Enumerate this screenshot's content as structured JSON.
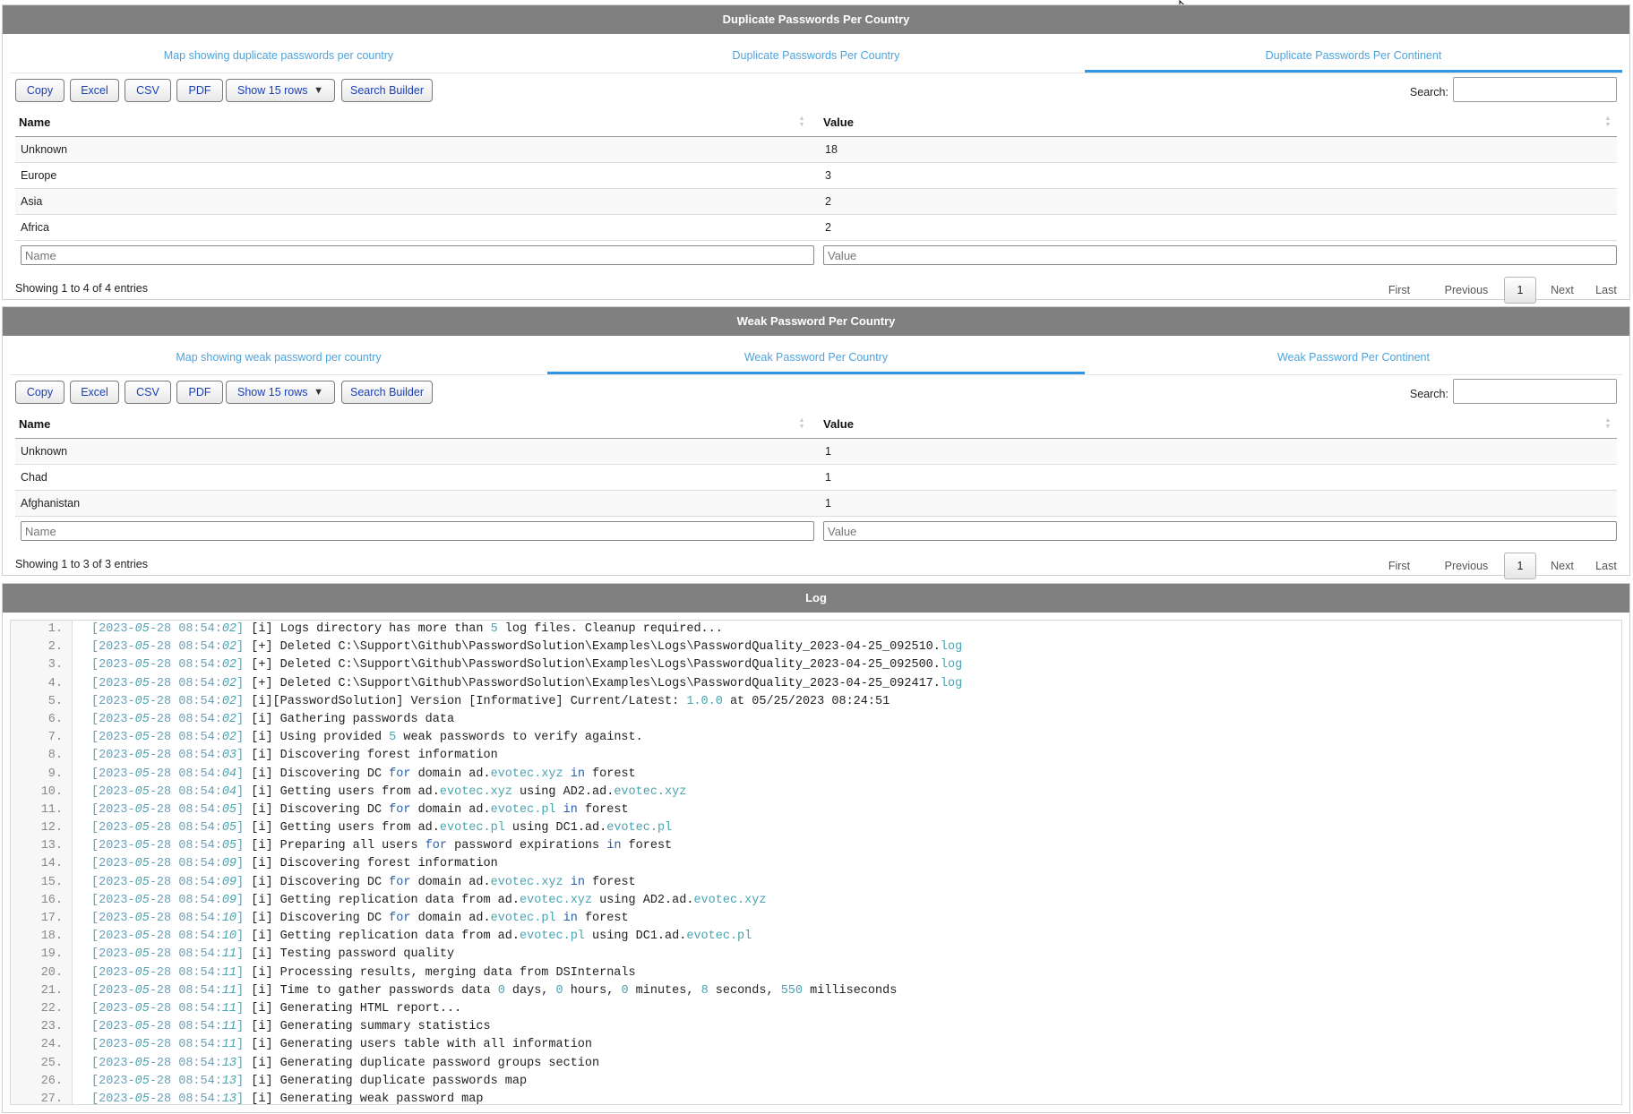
{
  "panel1": {
    "header": "Duplicate Passwords Per Country",
    "tabs": [
      "Map showing duplicate passwords per country",
      "Duplicate Passwords Per Country",
      "Duplicate Passwords Per Continent"
    ],
    "active_tab": 2,
    "buttons": {
      "copy": "Copy",
      "excel": "Excel",
      "csv": "CSV",
      "pdf": "PDF",
      "show_rows": "Show 15 rows",
      "search_builder": "Search Builder"
    },
    "search_label": "Search:",
    "columns": [
      "Name",
      "Value"
    ],
    "rows": [
      [
        "Unknown",
        "18"
      ],
      [
        "Europe",
        "3"
      ],
      [
        "Asia",
        "2"
      ],
      [
        "Africa",
        "2"
      ]
    ],
    "filter_placeholders": [
      "Name",
      "Value"
    ],
    "info": "Showing 1 to 4 of 4 entries",
    "pager": [
      "First",
      "Previous",
      "1",
      "Next",
      "Last"
    ]
  },
  "panel2": {
    "header": "Weak Password Per Country",
    "tabs": [
      "Map showing weak password per country",
      "Weak Password Per Country",
      "Weak Password Per Continent"
    ],
    "active_tab": 1,
    "buttons": {
      "copy": "Copy",
      "excel": "Excel",
      "csv": "CSV",
      "pdf": "PDF",
      "show_rows": "Show 15 rows",
      "search_builder": "Search Builder"
    },
    "search_label": "Search:",
    "columns": [
      "Name",
      "Value"
    ],
    "rows": [
      [
        "Unknown",
        "1"
      ],
      [
        "Chad",
        "1"
      ],
      [
        "Afghanistan",
        "1"
      ]
    ],
    "filter_placeholders": [
      "Name",
      "Value"
    ],
    "info": "Showing 1 to 3 of 3 entries",
    "pager": [
      "First",
      "Previous",
      "1",
      "Next",
      "Last"
    ]
  },
  "log": {
    "header": "Log",
    "lines": [
      {
        "n": "1.",
        "ts": "[2023-05-28 08:54:02]",
        "text": " [i] Logs directory has more than 5 log files. Cleanup required..."
      },
      {
        "n": "2.",
        "ts": "[2023-05-28 08:54:02]",
        "text": " [+] Deleted C:\\Support\\Github\\PasswordSolution\\Examples\\Logs\\PasswordQuality_2023-04-25_092510.log"
      },
      {
        "n": "3.",
        "ts": "[2023-05-28 08:54:02]",
        "text": " [+] Deleted C:\\Support\\Github\\PasswordSolution\\Examples\\Logs\\PasswordQuality_2023-04-25_092500.log"
      },
      {
        "n": "4.",
        "ts": "[2023-05-28 08:54:02]",
        "text": " [+] Deleted C:\\Support\\Github\\PasswordSolution\\Examples\\Logs\\PasswordQuality_2023-04-25_092417.log"
      },
      {
        "n": "5.",
        "ts": "[2023-05-28 08:54:02]",
        "text": " [i][PasswordSolution] Version [Informative] Current/Latest: 1.0.0 at 05/25/2023 08:24:51"
      },
      {
        "n": "6.",
        "ts": "[2023-05-28 08:54:02]",
        "text": " [i] Gathering passwords data"
      },
      {
        "n": "7.",
        "ts": "[2023-05-28 08:54:02]",
        "text": " [i] Using provided 5 weak passwords to verify against."
      },
      {
        "n": "8.",
        "ts": "[2023-05-28 08:54:03]",
        "text": " [i] Discovering forest information"
      },
      {
        "n": "9.",
        "ts": "[2023-05-28 08:54:04]",
        "text": " [i] Discovering DC for domain ad.evotec.xyz in forest"
      },
      {
        "n": "10.",
        "ts": "[2023-05-28 08:54:04]",
        "text": " [i] Getting users from ad.evotec.xyz using AD2.ad.evotec.xyz"
      },
      {
        "n": "11.",
        "ts": "[2023-05-28 08:54:05]",
        "text": " [i] Discovering DC for domain ad.evotec.pl in forest"
      },
      {
        "n": "12.",
        "ts": "[2023-05-28 08:54:05]",
        "text": " [i] Getting users from ad.evotec.pl using DC1.ad.evotec.pl"
      },
      {
        "n": "13.",
        "ts": "[2023-05-28 08:54:05]",
        "text": " [i] Preparing all users for password expirations in forest"
      },
      {
        "n": "14.",
        "ts": "[2023-05-28 08:54:09]",
        "text": " [i] Discovering forest information"
      },
      {
        "n": "15.",
        "ts": "[2023-05-28 08:54:09]",
        "text": " [i] Discovering DC for domain ad.evotec.xyz in forest"
      },
      {
        "n": "16.",
        "ts": "[2023-05-28 08:54:09]",
        "text": " [i] Getting replication data from ad.evotec.xyz using AD2.ad.evotec.xyz"
      },
      {
        "n": "17.",
        "ts": "[2023-05-28 08:54:10]",
        "text": " [i] Discovering DC for domain ad.evotec.pl in forest"
      },
      {
        "n": "18.",
        "ts": "[2023-05-28 08:54:10]",
        "text": " [i] Getting replication data from ad.evotec.pl using DC1.ad.evotec.pl"
      },
      {
        "n": "19.",
        "ts": "[2023-05-28 08:54:11]",
        "text": " [i] Testing password quality"
      },
      {
        "n": "20.",
        "ts": "[2023-05-28 08:54:11]",
        "text": " [i] Processing results, merging data from DSInternals"
      },
      {
        "n": "21.",
        "ts": "[2023-05-28 08:54:11]",
        "text": " [i] Time to gather passwords data 0 days, 0 hours, 0 minutes, 8 seconds, 550 milliseconds"
      },
      {
        "n": "22.",
        "ts": "[2023-05-28 08:54:11]",
        "text": " [i] Generating HTML report..."
      },
      {
        "n": "23.",
        "ts": "[2023-05-28 08:54:11]",
        "text": " [i] Generating summary statistics"
      },
      {
        "n": "24.",
        "ts": "[2023-05-28 08:54:11]",
        "text": " [i] Generating users table with all information"
      },
      {
        "n": "25.",
        "ts": "[2023-05-28 08:54:13]",
        "text": " [i] Generating duplicate password groups section"
      },
      {
        "n": "26.",
        "ts": "[2023-05-28 08:54:13]",
        "text": " [i] Generating duplicate passwords map"
      },
      {
        "n": "27.",
        "ts": "[2023-05-28 08:54:13]",
        "text": " [i] Generating weak password map"
      }
    ]
  },
  "colors": {
    "header_bg": "#808080",
    "tab_text": "#4ea3dc",
    "tab_active": "#2f97e0",
    "button_text": "#1a3fb5"
  },
  "icons": [
    "sort-arrows-icon",
    "dropdown-caret-icon",
    "mouse-cursor-icon"
  ]
}
